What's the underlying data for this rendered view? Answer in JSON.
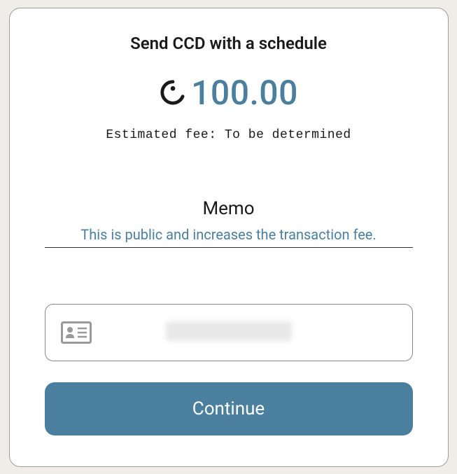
{
  "header": {
    "title": "Send CCD with a schedule"
  },
  "amount": {
    "value": "100.00",
    "currency_icon": "ccd"
  },
  "fee": {
    "label": "Estimated fee:",
    "value": "To be determined"
  },
  "memo": {
    "label": "Memo",
    "placeholder": "This is public and increases the transaction fee.",
    "value": ""
  },
  "recipient": {
    "name": ""
  },
  "actions": {
    "continue_label": "Continue"
  }
}
